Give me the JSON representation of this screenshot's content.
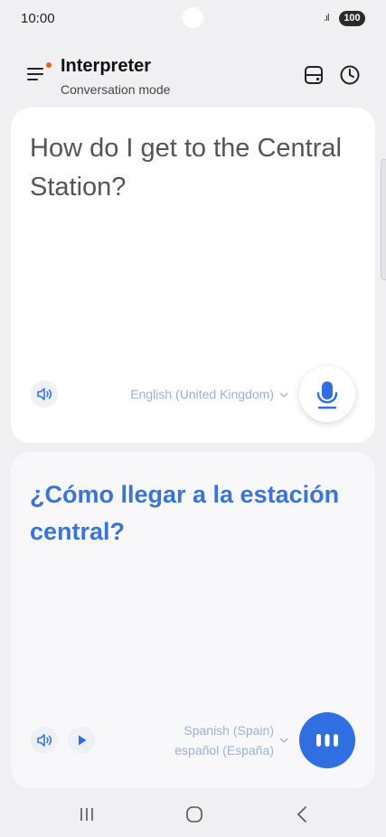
{
  "status": {
    "time": "10:00",
    "battery": "100"
  },
  "header": {
    "title": "Interpreter",
    "subtitle": "Conversation mode"
  },
  "source": {
    "text": "How do I get to the Central Station?",
    "language": "English (United Kingdom)"
  },
  "target": {
    "text": "¿Cómo llegar a la estación central?",
    "language": "Spanish (Spain)",
    "language_native": "español (España)"
  },
  "colors": {
    "accent": "#2f6fe2",
    "translation": "#3a74d6",
    "notification_dot": "#ef5a1f"
  },
  "icons": {
    "menu": "menu-icon",
    "screen": "screen-split-icon",
    "history": "clock-icon",
    "speaker": "speaker-icon",
    "mic": "microphone-icon",
    "play": "play-icon",
    "talk": "dots-icon",
    "nav_recent": "recent-apps-icon",
    "nav_home": "home-icon",
    "nav_back": "back-icon"
  }
}
